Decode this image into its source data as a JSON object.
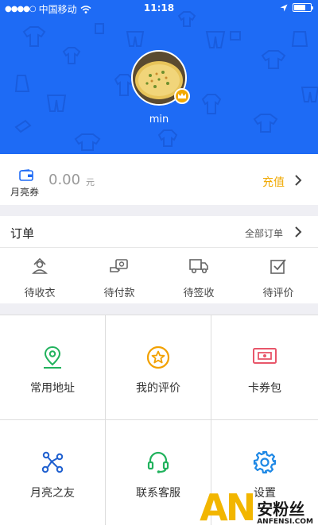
{
  "statusbar": {
    "signal": "●●●●○",
    "carrier": "中国移动",
    "time": "11:18"
  },
  "profile": {
    "username": "min"
  },
  "wallet": {
    "label": "月亮券",
    "amount": "0.00",
    "unit": "元",
    "recharge_label": "充值"
  },
  "orders": {
    "title": "订单",
    "all_label": "全部订单",
    "items": [
      {
        "label": "待收衣",
        "icon": "hanger-person-icon"
      },
      {
        "label": "待付款",
        "icon": "wallet-payment-icon"
      },
      {
        "label": "待签收",
        "icon": "delivery-truck-icon"
      },
      {
        "label": "待评价",
        "icon": "checkbox-review-icon"
      }
    ]
  },
  "services": [
    {
      "label": "常用地址",
      "icon": "location-pin-icon",
      "color": "#21b25d"
    },
    {
      "label": "我的评价",
      "icon": "star-circle-icon",
      "color": "#f2a100"
    },
    {
      "label": "卡券包",
      "icon": "ticket-icon",
      "color": "#e8566a"
    },
    {
      "label": "月亮之友",
      "icon": "friends-network-icon",
      "color": "#1e5fcf"
    },
    {
      "label": "联系客服",
      "icon": "headset-icon",
      "color": "#21b25d"
    },
    {
      "label": "设置",
      "icon": "gear-icon",
      "color": "#1e88e5"
    }
  ],
  "watermark": {
    "logo": "AN",
    "cn": "安粉丝",
    "en": "ANFENSI.COM"
  },
  "colors": {
    "header_bg": "#1e6bf5",
    "recharge": "#f0a800"
  }
}
